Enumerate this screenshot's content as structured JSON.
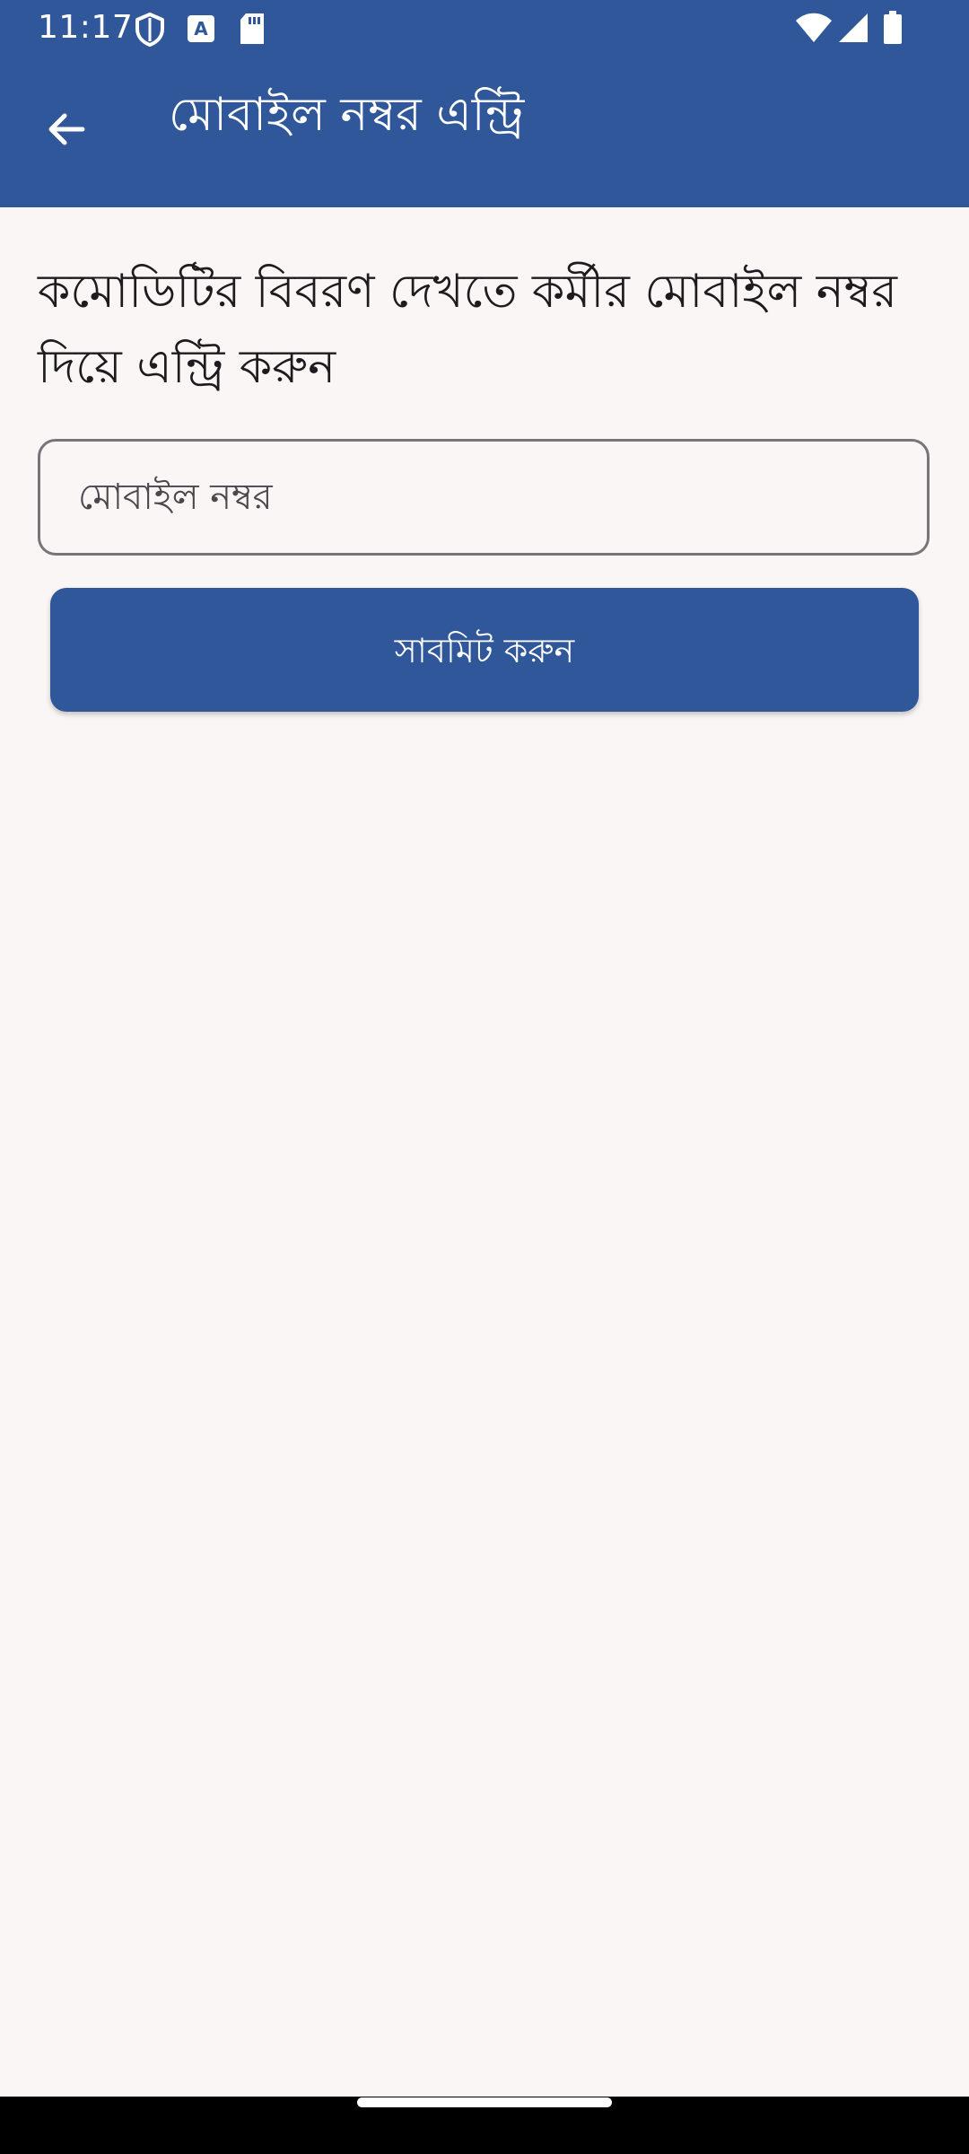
{
  "status_bar": {
    "time": "11:17",
    "icons": [
      "shield-icon",
      "text-a-icon",
      "sd-card-icon",
      "wifi-icon",
      "cell-signal-icon",
      "battery-icon"
    ]
  },
  "app_bar": {
    "back_icon": "arrow-back-icon",
    "title": "মোবাইল নম্বর এন্ট্রি"
  },
  "content": {
    "instruction": "কমোডিটির বিবরণ দেখতে কর্মীর মোবাইল নম্বর দিয়ে এন্ট্রি করুন",
    "mobile_input": {
      "placeholder": "মোবাইল নম্বর",
      "value": ""
    },
    "submit_label": "সাবমিট করুন"
  },
  "colors": {
    "primary": "#30579a",
    "background": "#faf6f5",
    "on_primary": "#ffffff",
    "text": "#1d1b1e",
    "outline": "#77757a"
  }
}
